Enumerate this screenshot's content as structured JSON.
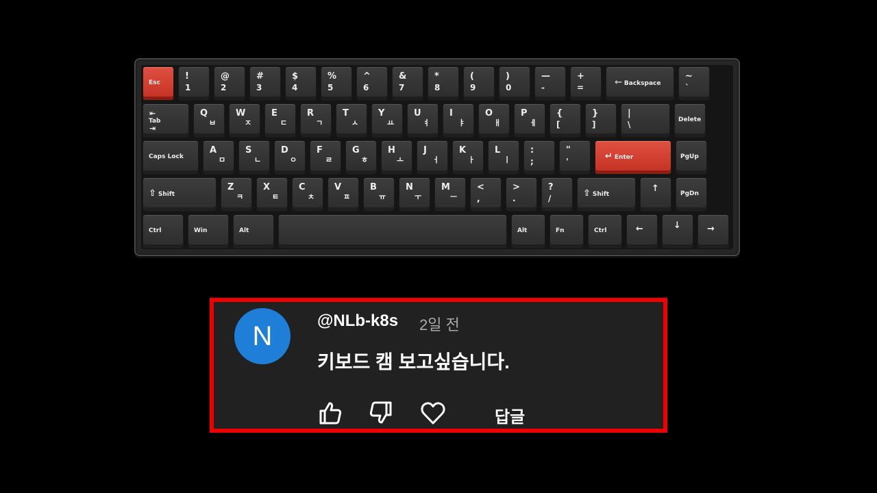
{
  "keyboard": {
    "row1": {
      "esc": "Esc",
      "k1": {
        "top": "!",
        "bot": "1"
      },
      "k2": {
        "top": "@",
        "bot": "2"
      },
      "k3": {
        "top": "#",
        "bot": "3"
      },
      "k4": {
        "top": "$",
        "bot": "4"
      },
      "k5": {
        "top": "%",
        "bot": "5"
      },
      "k6": {
        "top": "^",
        "bot": "6"
      },
      "k7": {
        "top": "&",
        "bot": "7"
      },
      "k8": {
        "top": "*",
        "bot": "8"
      },
      "k9": {
        "top": "(",
        "bot": "9"
      },
      "k0": {
        "top": ")",
        "bot": "0"
      },
      "minus": {
        "top": "—",
        "bot": "-"
      },
      "equal": {
        "top": "+",
        "bot": "="
      },
      "backspace": "Backspace",
      "tilde": {
        "top": "~",
        "bot": "`"
      }
    },
    "row2": {
      "tab": "Tab",
      "q": {
        "top": "Q",
        "kor": "ㅂ"
      },
      "w": {
        "top": "W",
        "kor": "ㅈ"
      },
      "e": {
        "top": "E",
        "kor": "ㄷ"
      },
      "r": {
        "top": "R",
        "kor": "ㄱ"
      },
      "t": {
        "top": "T",
        "kor": "ㅅ"
      },
      "y": {
        "top": "Y",
        "kor": "ㅛ"
      },
      "u": {
        "top": "U",
        "kor": "ㅕ"
      },
      "i": {
        "top": "I",
        "kor": "ㅑ"
      },
      "o": {
        "top": "O",
        "kor": "ㅐ"
      },
      "p": {
        "top": "P",
        "kor": "ㅔ"
      },
      "lbrace": {
        "top": "{",
        "bot": "["
      },
      "rbrace": {
        "top": "}",
        "bot": "]"
      },
      "pipe": {
        "top": "|",
        "bot": "\\"
      },
      "delete": "Delete"
    },
    "row3": {
      "caps": "Caps Lock",
      "a": {
        "top": "A",
        "kor": "ㅁ"
      },
      "s": {
        "top": "S",
        "kor": "ㄴ"
      },
      "d": {
        "top": "D",
        "kor": "ㅇ"
      },
      "f": {
        "top": "F",
        "kor": "ㄹ"
      },
      "g": {
        "top": "G",
        "kor": "ㅎ"
      },
      "h": {
        "top": "H",
        "kor": "ㅗ"
      },
      "j": {
        "top": "J",
        "kor": "ㅓ"
      },
      "k": {
        "top": "K",
        "kor": "ㅏ"
      },
      "l": {
        "top": "L",
        "kor": "ㅣ"
      },
      "semicolon": {
        "top": ":",
        "bot": ";"
      },
      "quote": {
        "top": "\"",
        "bot": "'"
      },
      "enter": "Enter",
      "pgup": "PgUp"
    },
    "row4": {
      "lshift": "Shift",
      "z": {
        "top": "Z",
        "kor": "ㅋ"
      },
      "x": {
        "top": "X",
        "kor": "ㅌ"
      },
      "c": {
        "top": "C",
        "kor": "ㅊ"
      },
      "v": {
        "top": "V",
        "kor": "ㅍ"
      },
      "b": {
        "top": "B",
        "kor": "ㅠ"
      },
      "n": {
        "top": "N",
        "kor": "ㅜ"
      },
      "m": {
        "top": "M",
        "kor": "ㅡ"
      },
      "comma": {
        "top": "<",
        "bot": ","
      },
      "period": {
        "top": ">",
        "bot": "."
      },
      "slash": {
        "top": "?",
        "bot": "/"
      },
      "rshift": "Shift",
      "up": "↑",
      "pgdn": "PgDn"
    },
    "row5": {
      "lctrl": "Ctrl",
      "win": "Win",
      "lalt": "Alt",
      "ralt": "Alt",
      "fn": "Fn",
      "rctrl": "Ctrl",
      "left": "←",
      "down": "↓",
      "right": "→"
    }
  },
  "comment": {
    "avatar_letter": "N",
    "author": "@NLb-k8s",
    "time": "2일 전",
    "text": "키보드 캠 보고싶습니다.",
    "reply_label": "답글"
  },
  "colors": {
    "accent_key": "#d43a2c",
    "highlight_border": "#ee0000",
    "avatar": "#1f7fd8"
  },
  "icons": {
    "like": "thumbs-up-icon",
    "dislike": "thumbs-down-icon",
    "heart": "heart-icon"
  }
}
